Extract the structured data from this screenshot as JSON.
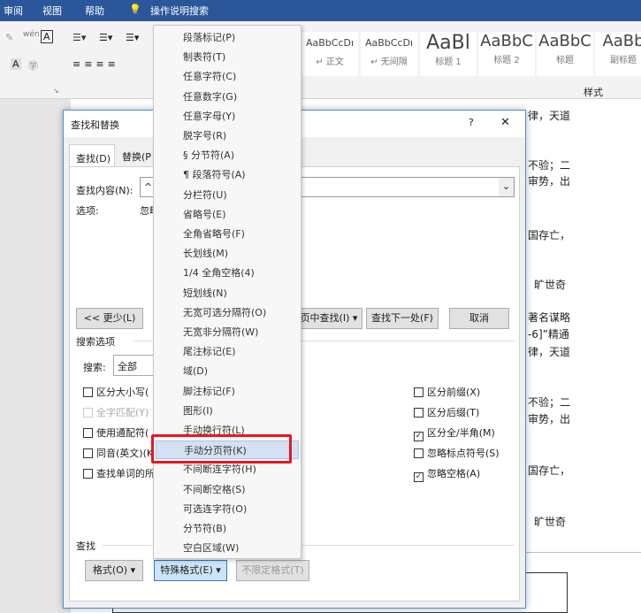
{
  "menubar": {
    "items": [
      "审阅",
      "视图",
      "帮助"
    ],
    "tell_me": "操作说明搜索"
  },
  "ribbon": {
    "styles": [
      {
        "preview": "AaBbCcDı",
        "name": "↵ 正文"
      },
      {
        "preview": "AaBbCcDı",
        "name": "↵ 无间隔"
      },
      {
        "preview": "AaBl",
        "name": "标题 1"
      },
      {
        "preview": "AaBbC",
        "name": "标题 2"
      },
      {
        "preview": "AaBbC",
        "name": "标题"
      },
      {
        "preview": "AaBb",
        "name": "副标题"
      }
    ],
    "styles_group": "样式"
  },
  "document": {
    "lines": [
      "律，天道",
      "不验；二",
      "审势，出",
      "国存亡，",
      "旷世奇",
      "著名谋略",
      "-6]”精通",
      "律，天道",
      "不验；二",
      "审势，出",
      "国存亡，",
      "旷世奇"
    ]
  },
  "dialog": {
    "title": "查找和替换",
    "help": "?",
    "close": "✕",
    "tabs": [
      "查找(D)",
      "替换(P"
    ],
    "find_label": "查找内容(N):",
    "find_value": "^m",
    "options_label": "选项:",
    "options_value": "忽略",
    "less_button": "<< 更少(L)",
    "find_in_button": "页中查找(I) ▾",
    "find_next_button": "查找下一处(F)",
    "cancel_button": "取消",
    "search_options_label": "搜索选项",
    "search_label": "搜索:",
    "search_value": "全部",
    "left_checks": [
      {
        "label": "区分大小写(",
        "checked": false
      },
      {
        "label": "全字匹配(Y)",
        "checked": false,
        "disabled": true
      },
      {
        "label": "使用通配符(",
        "checked": false
      },
      {
        "label": "同音(英文)(K",
        "checked": false
      },
      {
        "label": "查找单词的所",
        "checked": false
      }
    ],
    "right_checks": [
      {
        "label": "区分前缀(X)",
        "checked": false
      },
      {
        "label": "区分后缀(T)",
        "checked": false
      },
      {
        "label": "区分全/半角(M)",
        "checked": true
      },
      {
        "label": "忽略标点符号(S)",
        "checked": false
      },
      {
        "label": "忽略空格(A)",
        "checked": true
      }
    ],
    "find_section": "查找",
    "format_button": "格式(O) ▾",
    "special_button": "特殊格式(E) ▾",
    "no_format_button": "不限定格式(T)"
  },
  "special_menu": {
    "highlighted_index": 21,
    "items": [
      "段落标记(P)",
      "制表符(T)",
      "任意字符(C)",
      "任意数字(G)",
      "任意字母(Y)",
      "脱字号(R)",
      "§ 分节符(A)",
      "¶ 段落符号(A)",
      "分栏符(U)",
      "省略号(E)",
      "全角省略号(F)",
      "长划线(M)",
      "1/4 全角空格(4)",
      "短划线(N)",
      "无宽可选分隔符(O)",
      "无宽非分隔符(W)",
      "尾注标记(E)",
      "域(D)",
      "脚注标记(F)",
      "图形(I)",
      "手动换行符(L)",
      "手动分页符(K)",
      "不间断连字符(H)",
      "不间断空格(S)",
      "可选连字符(O)",
      "分节符(B)",
      "空白区域(W)"
    ]
  },
  "colors": {
    "title_bar": "#2b579a",
    "highlight": "#d5e1f2",
    "annotation": "#e8171f"
  }
}
